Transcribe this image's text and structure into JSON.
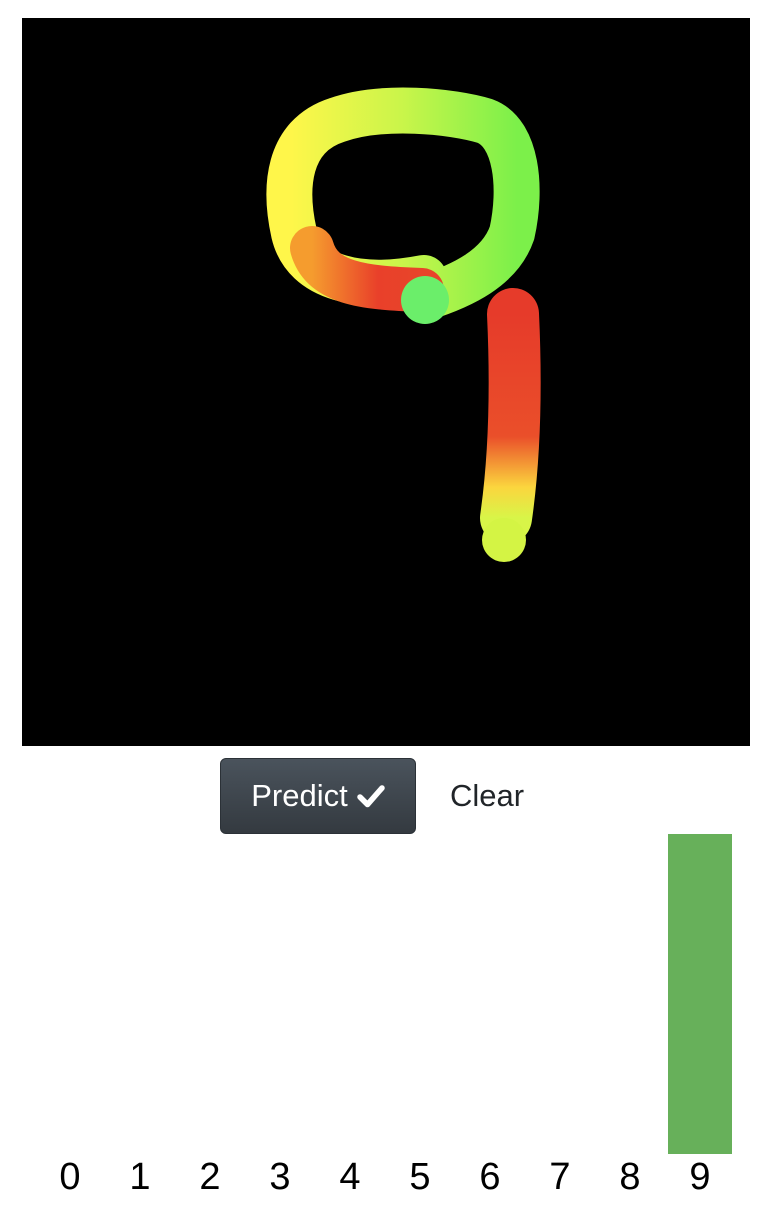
{
  "canvas": {
    "description_icon": "drawing-canvas",
    "background": "#000000"
  },
  "buttons": {
    "predict_label": "Predict",
    "predict_icon": "check-icon",
    "clear_label": "Clear"
  },
  "chart_data": {
    "type": "bar",
    "categories": [
      "0",
      "1",
      "2",
      "3",
      "4",
      "5",
      "6",
      "7",
      "8",
      "9"
    ],
    "values": [
      0,
      0,
      0,
      0,
      0,
      0,
      0,
      0,
      0,
      1
    ],
    "ylim": [
      0,
      1
    ],
    "bar_color": "#67b05a",
    "grid": false,
    "title": "",
    "xlabel": "",
    "ylabel": ""
  }
}
